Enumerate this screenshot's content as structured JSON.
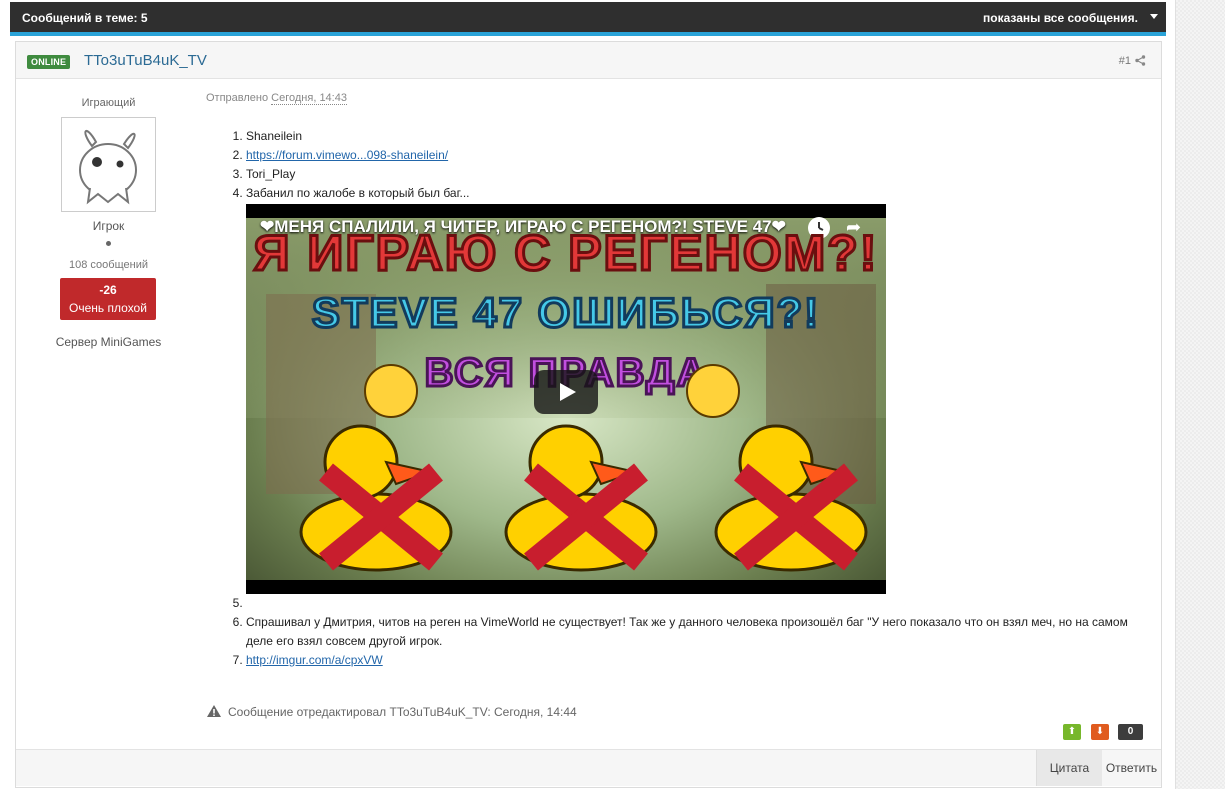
{
  "topbar": {
    "left_text": "Сообщений в теме: 5",
    "right_text": "показаны все сообщения.",
    "dropdown_icon": "caret-down-icon"
  },
  "post": {
    "status_badge": "ONLINE",
    "author_name": "TTo3uTuB4uK_TV",
    "post_number": "#1",
    "share_icon": "share-icon",
    "posted_label": "Отправлено",
    "posted_date": "Сегодня, 14:43",
    "author": {
      "group_title": "Играющий",
      "rank": "Игрок",
      "post_count": "108 сообщений",
      "reputation_value": "-26",
      "reputation_label": "Очень плохой",
      "server": "Сервер MiniGames"
    },
    "items": [
      {
        "text": "Shaneilein"
      },
      {
        "link": "https://forum.vimewo...098-shaneilein/"
      },
      {
        "text": "Tori_Play"
      },
      {
        "text": "Забанил по жалобе в который был баг..."
      },
      {
        "text": ""
      },
      {
        "text": "Спрашивал у Дмитрия, читов на реген на VimeWorld не существует! Так же у данного человека произошёл баг \"У него показало что он взял меч, но на самом деле его взял совсем другой игрок."
      },
      {
        "link": "http://imgur.com/a/cpxVW"
      }
    ],
    "video": {
      "title": "❤МЕНЯ СПАЛИЛИ, Я ЧИТЕР, ИГРАЮ С РЕГЕНОМ?! STEVE 47❤",
      "thumb_line1": "Я ИГРАЮ С РЕГЕНОМ?!",
      "thumb_line2": "STEVE 47 ОШИБЬСЯ?!",
      "thumb_line3": "ВСЯ ПРАВДА"
    },
    "edited_note": "Сообщение отредактировал TTo3uTuB4uK_TV: Сегодня, 14:44",
    "votes": {
      "count": "0",
      "up_icon": "arrow-up-icon",
      "down_icon": "arrow-down-icon"
    },
    "footer": {
      "quote_label": "Цитата",
      "reply_label": "Ответить"
    }
  }
}
